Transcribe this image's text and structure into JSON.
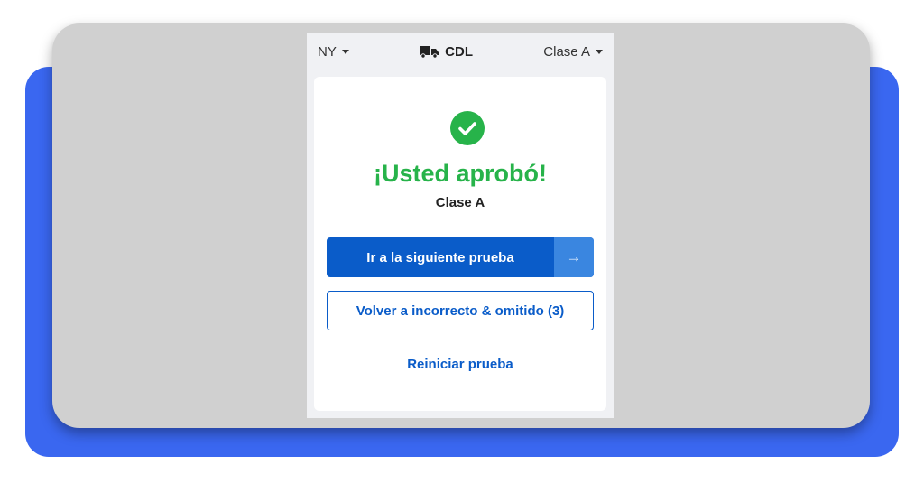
{
  "header": {
    "state_selector": "NY",
    "brand_label": "CDL",
    "class_selector": "Clase A"
  },
  "result": {
    "title": "¡Usted aprobó!",
    "subtitle": "Clase A"
  },
  "actions": {
    "next_test_label": "Ir a la siguiente prueba",
    "next_test_arrow": "→",
    "review_label": "Volver a incorrecto & omitido (3)",
    "restart_label": "Reiniciar prueba"
  },
  "colors": {
    "accent_blue": "#0a5cc9",
    "success_green": "#27b34a",
    "backdrop_blue": "#3a67f0"
  }
}
